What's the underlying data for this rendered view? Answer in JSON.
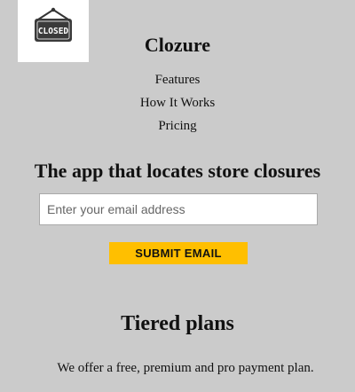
{
  "header": {
    "logo_icon": "closed-sign-icon",
    "logo_sign_text": "CLOSED",
    "brand_name": "Clozure"
  },
  "nav": {
    "items": [
      {
        "label": "Features"
      },
      {
        "label": "How It Works"
      },
      {
        "label": "Pricing"
      }
    ]
  },
  "hero": {
    "title": "The app that locates store closures",
    "email_placeholder": "Enter your email address",
    "submit_label": "SUBMIT EMAIL"
  },
  "plans": {
    "title": "Tiered plans",
    "description": "We offer a free, premium and pro payment plan."
  },
  "colors": {
    "background": "#cbcbcb",
    "button": "#ffbf00",
    "logo_background": "#ffffff"
  }
}
